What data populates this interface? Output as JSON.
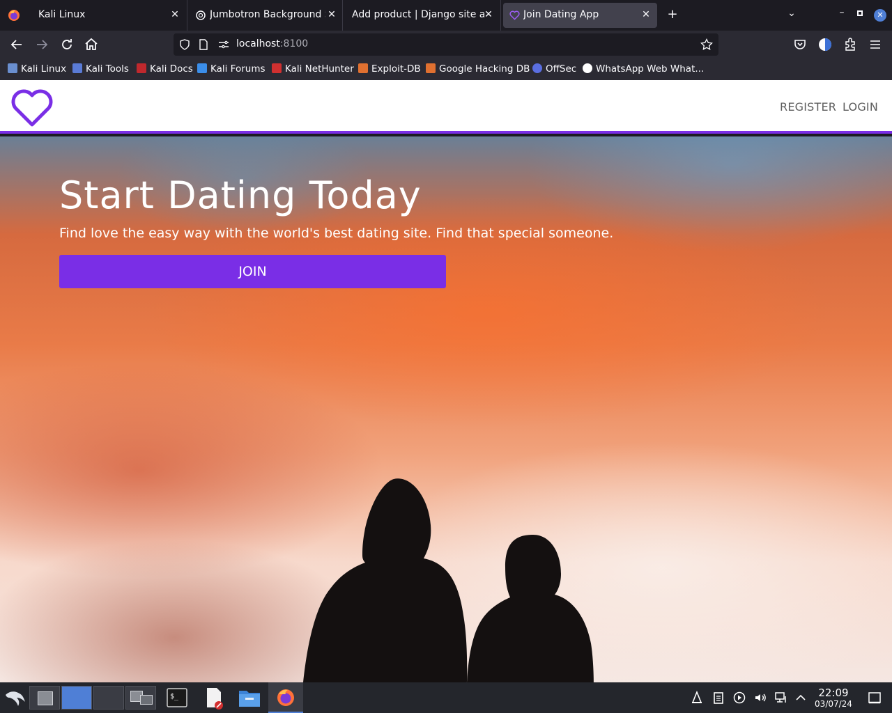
{
  "browser": {
    "tabs": [
      {
        "label": "Kali Linux",
        "active": false
      },
      {
        "label": "Jumbotron Background Sli",
        "active": false
      },
      {
        "label": "Add product | Django site adr",
        "active": false
      },
      {
        "label": "Join Dating App",
        "active": true
      }
    ],
    "url_host": "localhost",
    "url_port": ":8100",
    "bookmarks": [
      {
        "label": "Kali Linux",
        "color": "#3b8eea"
      },
      {
        "label": "Kali Tools",
        "color": "#e04848"
      },
      {
        "label": "Kali Docs",
        "color": "#c0282d"
      },
      {
        "label": "Kali Forums",
        "color": "#3b8eea"
      },
      {
        "label": "Kali NetHunter",
        "color": "#d03030"
      },
      {
        "label": "Exploit-DB",
        "color": "#e07030"
      },
      {
        "label": "Google Hacking DB",
        "color": "#e07030"
      },
      {
        "label": "OffSec",
        "color": "#5a6ee0"
      },
      {
        "label": "WhatsApp Web What...",
        "color": "#ffffff"
      }
    ]
  },
  "site": {
    "nav": {
      "register": "REGISTER",
      "login": "LOGIN"
    },
    "hero": {
      "title": "Start Dating Today",
      "subtitle": "Find love the easy way with the world's best dating site. Find that special someone.",
      "join_label": "JOIN"
    },
    "accent_color": "#7a2ee6"
  },
  "taskbar": {
    "time": "22:09",
    "date": "03/07/24"
  }
}
